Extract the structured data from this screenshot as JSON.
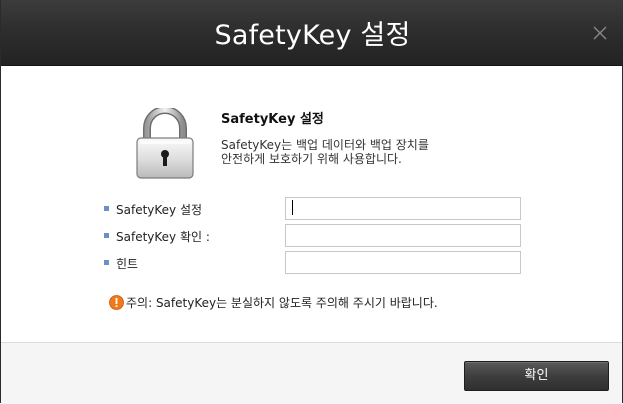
{
  "window": {
    "title": "SafetyKey 설정",
    "close_icon": "close-icon"
  },
  "header": {
    "lock_icon": "padlock-icon",
    "section_title": "SafetyKey 설정",
    "description_line1": "SafetyKey는 백업 데이터와 백업 장치를",
    "description_line2": "안전하게 보호하기 위해 사용합니다."
  },
  "form": {
    "fields": [
      {
        "label": "SafetyKey 설정",
        "value": "",
        "placeholder": ""
      },
      {
        "label": "SafetyKey 확인 :",
        "value": "",
        "placeholder": ""
      },
      {
        "label": "힌트",
        "value": "",
        "placeholder": ""
      }
    ]
  },
  "warning": {
    "icon": "warning-icon",
    "text": "주의: SafetyKey는 분실하지 않도록 주의해 주시기 바랍니다."
  },
  "footer": {
    "confirm_label": "확인"
  },
  "colors": {
    "titlebar": "#2e2e2e",
    "bullet": "#6b8fc9",
    "warning": "#f07a1a",
    "button": "#3e3e3e"
  }
}
